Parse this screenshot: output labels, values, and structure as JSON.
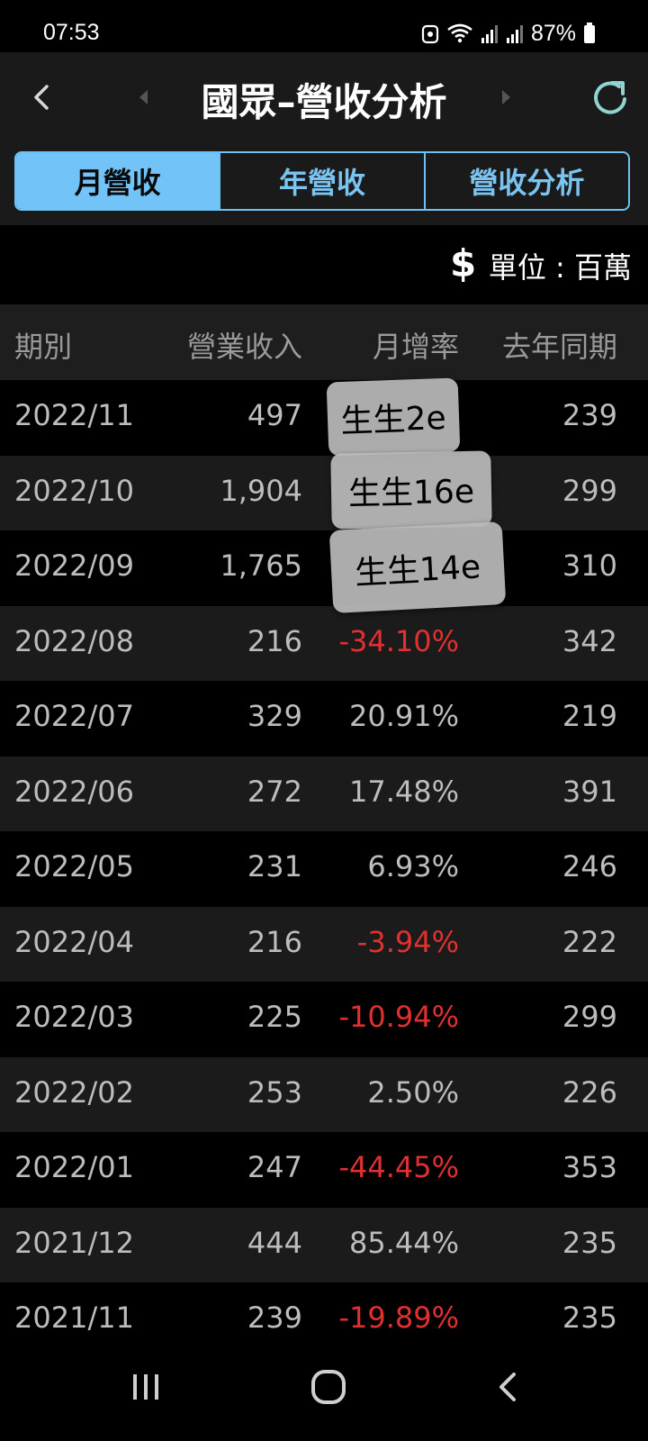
{
  "status": {
    "time": "07:53",
    "battery": "87%"
  },
  "header": {
    "title": "國眾–營收分析"
  },
  "tabs": [
    {
      "label": "月營收",
      "active": true
    },
    {
      "label": "年營收",
      "active": false
    },
    {
      "label": "營收分析",
      "active": false
    }
  ],
  "unit": {
    "icon": "$",
    "text": "單位 : 百萬"
  },
  "table": {
    "headers": {
      "period": "期別",
      "revenue": "營業收入",
      "mom": "月增率",
      "last_year": "去年同期"
    },
    "rows": [
      {
        "period": "2022/11",
        "revenue": "497",
        "mom": "",
        "mom_negative": false,
        "last_year": "239"
      },
      {
        "period": "2022/10",
        "revenue": "1,904",
        "mom": "",
        "mom_negative": false,
        "last_year": "299"
      },
      {
        "period": "2022/09",
        "revenue": "1,765",
        "mom": "",
        "mom_negative": false,
        "last_year": "310"
      },
      {
        "period": "2022/08",
        "revenue": "216",
        "mom": "-34.10%",
        "mom_negative": true,
        "last_year": "342"
      },
      {
        "period": "2022/07",
        "revenue": "329",
        "mom": "20.91%",
        "mom_negative": false,
        "last_year": "219"
      },
      {
        "period": "2022/06",
        "revenue": "272",
        "mom": "17.48%",
        "mom_negative": false,
        "last_year": "391"
      },
      {
        "period": "2022/05",
        "revenue": "231",
        "mom": "6.93%",
        "mom_negative": false,
        "last_year": "246"
      },
      {
        "period": "2022/04",
        "revenue": "216",
        "mom": "-3.94%",
        "mom_negative": true,
        "last_year": "222"
      },
      {
        "period": "2022/03",
        "revenue": "225",
        "mom": "-10.94%",
        "mom_negative": true,
        "last_year": "299"
      },
      {
        "period": "2022/02",
        "revenue": "253",
        "mom": "2.50%",
        "mom_negative": false,
        "last_year": "226"
      },
      {
        "period": "2022/01",
        "revenue": "247",
        "mom": "-44.45%",
        "mom_negative": true,
        "last_year": "353"
      },
      {
        "period": "2021/12",
        "revenue": "444",
        "mom": "85.44%",
        "mom_negative": false,
        "last_year": "235"
      },
      {
        "period": "2021/11",
        "revenue": "239",
        "mom": "-19.89%",
        "mom_negative": true,
        "last_year": "235"
      }
    ]
  },
  "stickers": [
    {
      "text": "生生2e"
    },
    {
      "text": "生生16e"
    },
    {
      "text": "生生14e"
    }
  ],
  "colors": {
    "accent": "#72c3f7",
    "negative": "#e0302f",
    "refresh": "#8fd4d0"
  },
  "icons": {
    "back": "chevron-left-icon",
    "prev": "caret-left-icon",
    "next": "caret-right-icon",
    "refresh": "refresh-icon",
    "nav_recent": "recent-apps-icon",
    "nav_home": "home-icon",
    "nav_back": "back-icon"
  }
}
